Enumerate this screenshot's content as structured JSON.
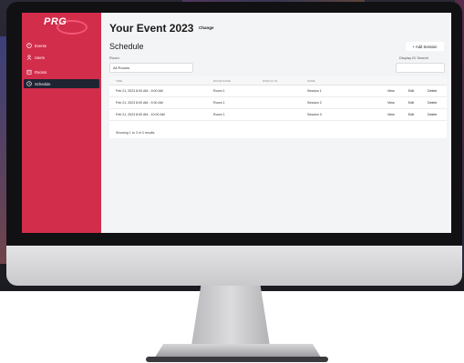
{
  "app": {
    "logo_text": "PRG",
    "event_title": "Your Event 2023",
    "change_label": "Change"
  },
  "sidebar": {
    "items": [
      {
        "label": "Events",
        "icon": "calendar-icon",
        "active": false
      },
      {
        "label": "Users",
        "icon": "user-icon",
        "active": false
      },
      {
        "label": "Rooms",
        "icon": "building-icon",
        "active": false
      },
      {
        "label": "Schedule",
        "icon": "clock-icon",
        "active": true
      }
    ]
  },
  "schedule": {
    "title": "Schedule",
    "add_button_label": "+ Add Session",
    "room_label": "Room",
    "room_value": "All Rooms",
    "search_label": "Display ID Search",
    "search_placeholder": "",
    "columns": [
      "TIME",
      "ROOM NAME",
      "DISPLAY ID",
      "NAME"
    ],
    "rows": [
      {
        "time": "Feb 21, 2023 8:00 AM - 9:00 AM",
        "room": "Room 1",
        "display_id": "",
        "name": "Session 1"
      },
      {
        "time": "Feb 21, 2023 8:00 AM - 9:30 AM",
        "room": "Room 1",
        "display_id": "",
        "name": "Session 2"
      },
      {
        "time": "Feb 21, 2023 8:00 AM - 10:00 AM",
        "room": "Room 1",
        "display_id": "",
        "name": "Session 3"
      }
    ],
    "actions": {
      "view": "View",
      "edit": "Edit",
      "delete": "Delete"
    },
    "footer": "Showing 1 to 3 of 3 results."
  },
  "colors": {
    "sidebar_bg": "#d22d4b",
    "active_item_bg": "#1f2433",
    "content_bg": "#f3f4f6"
  }
}
